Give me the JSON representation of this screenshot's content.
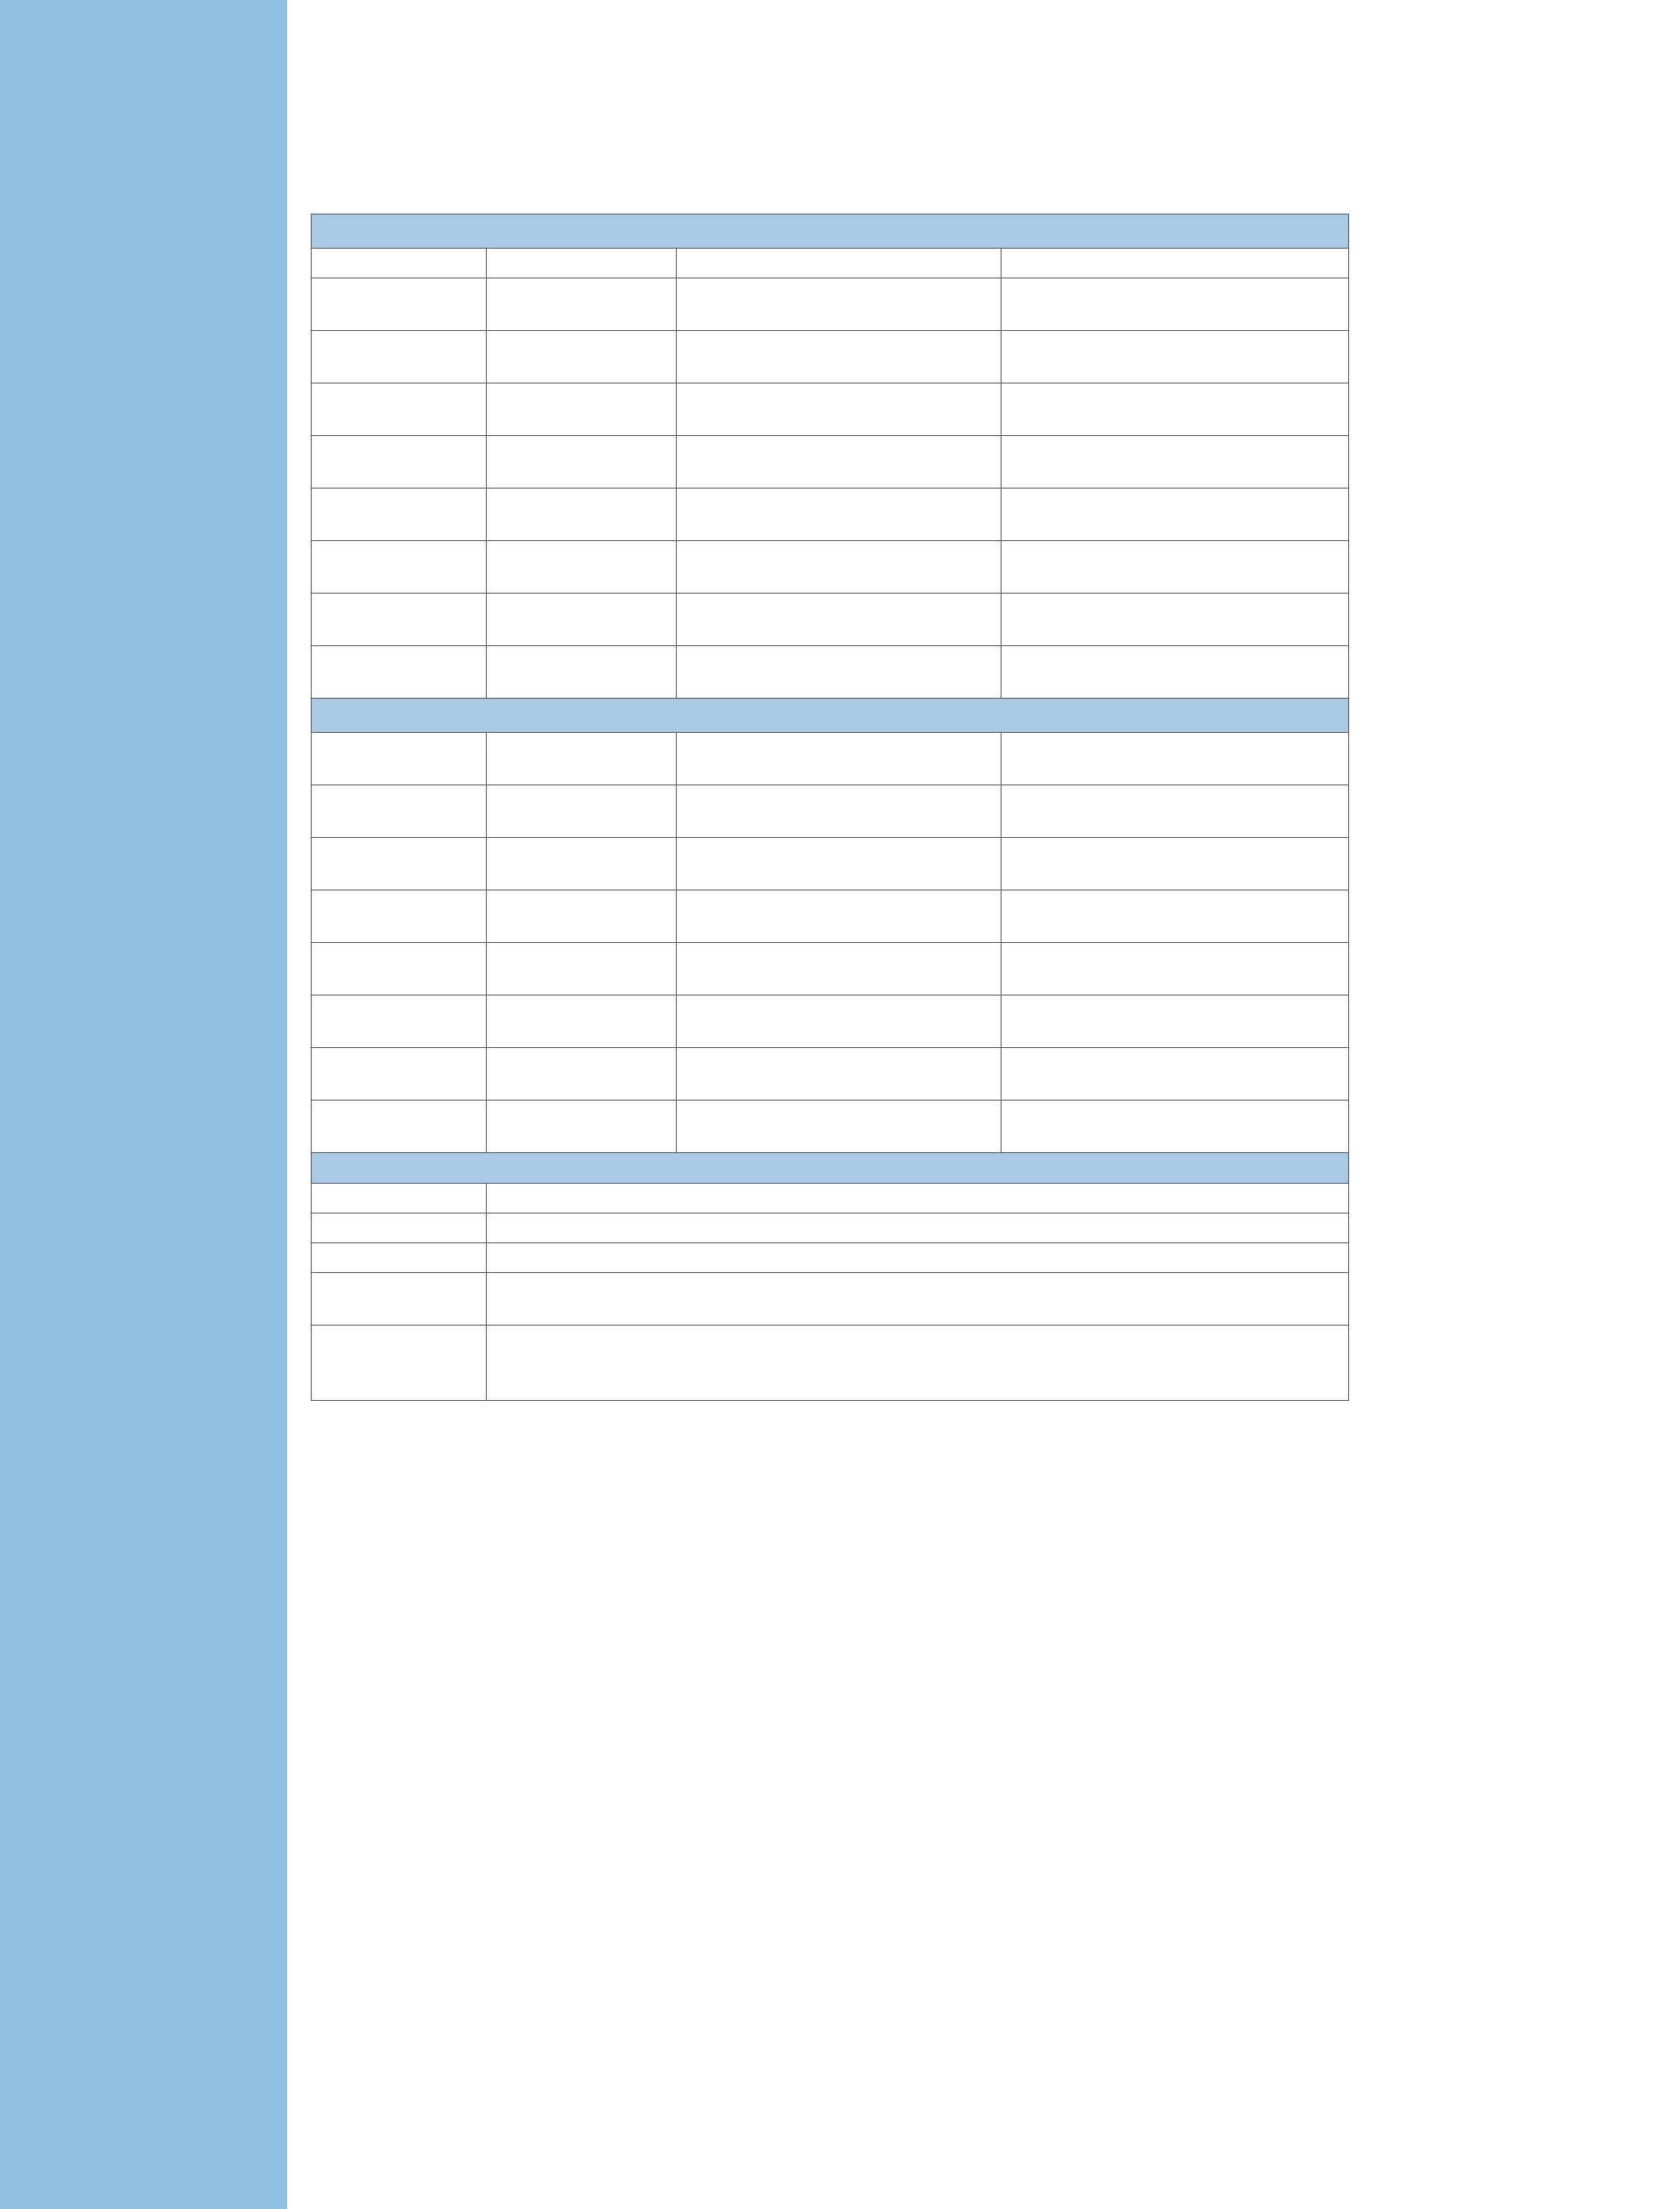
{
  "colors": {
    "sidebar_band": "#94c2e2",
    "section_header_fill": "#a9c9e5",
    "grid_line": "#5a5a5a",
    "page_background": "#ffffff"
  },
  "form": {
    "section_1": {
      "header": "",
      "column_headers": [
        "",
        "",
        "",
        ""
      ],
      "rows": [
        [
          "",
          "",
          "",
          ""
        ],
        [
          "",
          "",
          "",
          ""
        ],
        [
          "",
          "",
          "",
          ""
        ],
        [
          "",
          "",
          "",
          ""
        ],
        [
          "",
          "",
          "",
          ""
        ],
        [
          "",
          "",
          "",
          ""
        ],
        [
          "",
          "",
          "",
          ""
        ],
        [
          "",
          "",
          "",
          ""
        ]
      ]
    },
    "section_2": {
      "header": "",
      "rows": [
        [
          "",
          "",
          "",
          ""
        ],
        [
          "",
          "",
          "",
          ""
        ],
        [
          "",
          "",
          "",
          ""
        ],
        [
          "",
          "",
          "",
          ""
        ],
        [
          "",
          "",
          "",
          ""
        ],
        [
          "",
          "",
          "",
          ""
        ],
        [
          "",
          "",
          "",
          ""
        ],
        [
          "",
          "",
          "",
          ""
        ]
      ]
    },
    "section_3": {
      "header": "",
      "rows": [
        [
          "",
          ""
        ],
        [
          "",
          ""
        ],
        [
          "",
          ""
        ],
        [
          "",
          ""
        ],
        [
          "",
          ""
        ]
      ]
    }
  }
}
